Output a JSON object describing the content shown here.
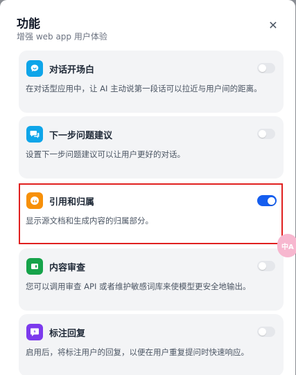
{
  "header": {
    "title": "功能",
    "subtitle": "增强 web app 用户体验",
    "close_label": "✕"
  },
  "features": [
    {
      "title": "对话开场白",
      "description": "在对话型应用中，让 AI 主动说第一段话可以拉近与用户间的距离。",
      "enabled": false,
      "icon": "chat-opener-icon",
      "icon_color": "#0ea5e9"
    },
    {
      "title": "下一步问题建议",
      "description": "设置下一步问题建议可以让用户更好的对话。",
      "enabled": false,
      "icon": "chat-bubbles-icon",
      "icon_color": "#0ea5e9"
    },
    {
      "title": "引用和归属",
      "description": "显示源文档和生成内容的归属部分。",
      "enabled": true,
      "icon": "quote-icon",
      "icon_color": "#f79009"
    },
    {
      "title": "内容审查",
      "description": "您可以调用审查 API 或者维护敏感词库来使模型更安全地输出。",
      "enabled": false,
      "icon": "shield-check-icon",
      "icon_color": "#16a34a"
    },
    {
      "title": "标注回复",
      "description": "启用后，将标注用户的回复，以便在用户重复提问时快速响应。",
      "enabled": false,
      "icon": "annotation-icon",
      "icon_color": "#7c3aed"
    }
  ],
  "side_bubble": {
    "label": "中A"
  },
  "colors": {
    "toggle_on": "#155eef",
    "toggle_off": "#e5e7eb",
    "highlight_border": "#e0201f",
    "card_bg": "#f3f4f6"
  }
}
